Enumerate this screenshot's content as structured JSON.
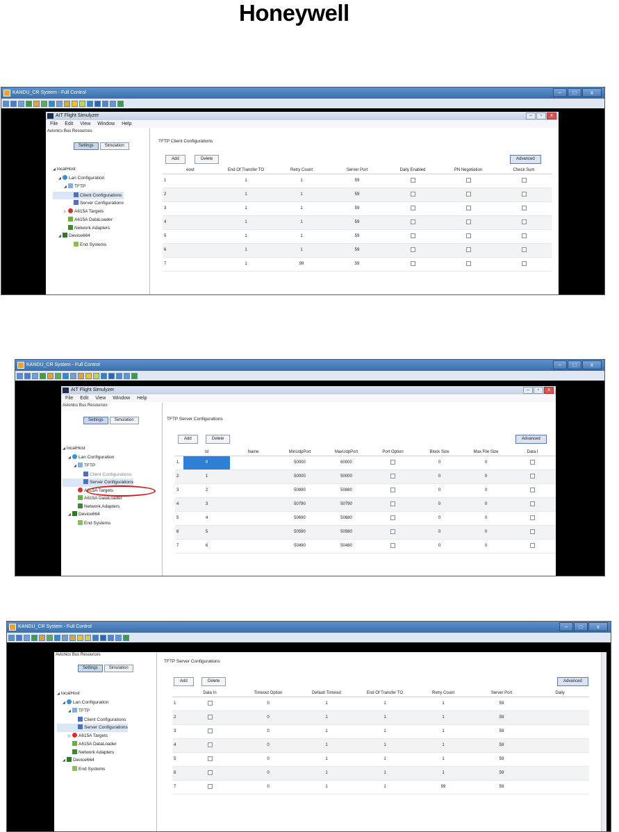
{
  "logo": "Honeywell",
  "window_title": "KANDU_CR System - Full Control",
  "inner_title": "AIT Flight Simulyzer",
  "menu": [
    "File",
    "Edit",
    "View",
    "Window",
    "Help"
  ],
  "left_panel": {
    "title": "Avionics Bus Resources",
    "settings_label": "Settings",
    "simulation_label": "Simulation"
  },
  "tree": {
    "localhost": "localHost",
    "lan": "Lan Configuration",
    "tftp": "TFTP",
    "client": "Client Configurations",
    "server": "Server Configurations",
    "targets": "A615A Targets",
    "loader": "A615A DataLoader",
    "adapters": "Network Adapters",
    "device": "Device664",
    "endsys": "End Systems"
  },
  "buttons": {
    "add": "Add",
    "delete": "Delete",
    "advanced": "Advanced"
  },
  "shot1": {
    "heading": "TFTP Client Configurations",
    "columns": [
      "eout",
      "End Of Transfer TO",
      "Retry Count",
      "Server Port",
      "Daily Enabled",
      "PN Negotiation",
      "Check Sum"
    ],
    "rows": [
      [
        "1",
        "1",
        "1",
        "59"
      ],
      [
        "2",
        "1",
        "1",
        "59"
      ],
      [
        "3",
        "1",
        "1",
        "59"
      ],
      [
        "4",
        "1",
        "1",
        "59"
      ],
      [
        "5",
        "1",
        "1",
        "59"
      ],
      [
        "6",
        "1",
        "1",
        "59"
      ],
      [
        "7",
        "1",
        "99",
        "59"
      ]
    ]
  },
  "shot2": {
    "heading": "TFTP Server Configurations",
    "columns": [
      "Id",
      "Name",
      "MinUdpPort",
      "MaxUdpPort",
      "Port Option",
      "Block Size",
      "Max File Size",
      "Data I"
    ],
    "rows": [
      [
        "1",
        "0",
        "",
        "50000",
        "60000",
        "0",
        "0"
      ],
      [
        "2",
        "1",
        "",
        "50000",
        "50000",
        "0",
        "0"
      ],
      [
        "3",
        "2",
        "",
        "50890",
        "50880",
        "0",
        "0"
      ],
      [
        "4",
        "3",
        "",
        "50790",
        "50790",
        "0",
        "0"
      ],
      [
        "5",
        "4",
        "",
        "50690",
        "50680",
        "0",
        "0"
      ],
      [
        "6",
        "5",
        "",
        "50590",
        "50580",
        "0",
        "0"
      ],
      [
        "7",
        "6",
        "",
        "50490",
        "50480",
        "0",
        "0"
      ]
    ]
  },
  "shot3": {
    "heading": "TFTP Server Configurations",
    "columns": [
      "Data In",
      "Timeout Option",
      "Default Timeout",
      "End Of Transfer TO",
      "Retry Count",
      "Server Port",
      "Daily"
    ],
    "rows": [
      [
        "1",
        "0",
        "1",
        "1",
        "1",
        "59"
      ],
      [
        "2",
        "0",
        "1",
        "1",
        "1",
        "59"
      ],
      [
        "3",
        "0",
        "1",
        "1",
        "1",
        "59"
      ],
      [
        "4",
        "0",
        "1",
        "1",
        "1",
        "59"
      ],
      [
        "5",
        "0",
        "1",
        "1",
        "1",
        "59"
      ],
      [
        "6",
        "0",
        "1",
        "1",
        "1",
        "59"
      ],
      [
        "7",
        "0",
        "1",
        "1",
        "99",
        "59"
      ]
    ]
  }
}
